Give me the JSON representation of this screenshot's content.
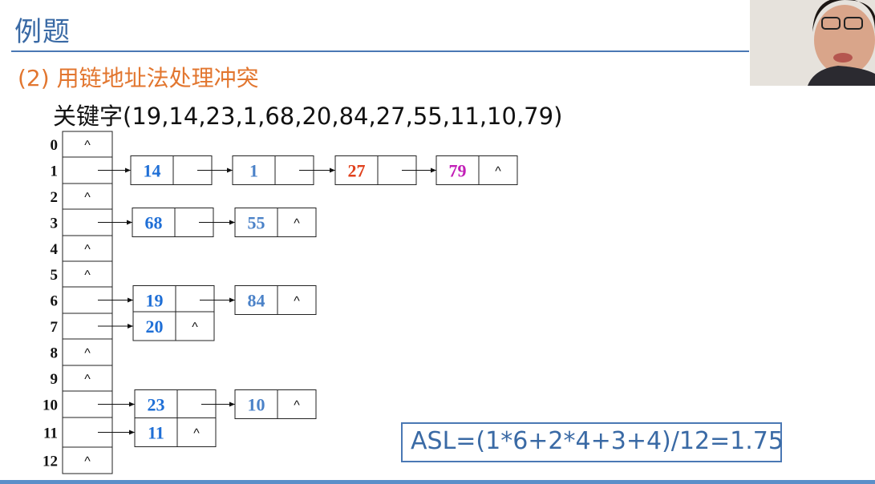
{
  "slide": {
    "title": "例题",
    "subtitle": "(2)  用链地址法处理冲突",
    "keywords": "关键字(19,14,23,1,68,20,84,27,55,11,10,79)",
    "asl": "ASL=(1*6+2*4+3+4)/12=1.75"
  },
  "null_symbol": "^",
  "colors": {
    "accent": "#3a6aa5",
    "subtitle": "#e2762f",
    "key_blue": "#1f6fd6",
    "key_lightblue": "#4b82c8",
    "key_red": "#e0401c",
    "key_magenta": "#c21fb7"
  },
  "hash_table": [
    {
      "index": "0",
      "chain": []
    },
    {
      "index": "1",
      "chain": [
        {
          "key": "14",
          "color": "#1f6fd6"
        },
        {
          "key": "1",
          "color": "#4b82c8"
        },
        {
          "key": "27",
          "color": "#e0401c"
        },
        {
          "key": "79",
          "color": "#c21fb7"
        }
      ]
    },
    {
      "index": "2",
      "chain": []
    },
    {
      "index": "3",
      "chain": [
        {
          "key": "68",
          "color": "#1f6fd6"
        },
        {
          "key": "55",
          "color": "#4b82c8"
        }
      ]
    },
    {
      "index": "4",
      "chain": []
    },
    {
      "index": "5",
      "chain": []
    },
    {
      "index": "6",
      "chain": [
        {
          "key": "19",
          "color": "#1f6fd6"
        },
        {
          "key": "84",
          "color": "#4b82c8"
        }
      ]
    },
    {
      "index": "7",
      "chain": [
        {
          "key": "20",
          "color": "#1f6fd6"
        }
      ]
    },
    {
      "index": "8",
      "chain": []
    },
    {
      "index": "9",
      "chain": []
    },
    {
      "index": "10",
      "chain": [
        {
          "key": "23",
          "color": "#1f6fd6"
        },
        {
          "key": "10",
          "color": "#4b82c8"
        }
      ]
    },
    {
      "index": "11",
      "chain": [
        {
          "key": "11",
          "color": "#1f6fd6"
        }
      ]
    },
    {
      "index": "12",
      "chain": []
    }
  ]
}
